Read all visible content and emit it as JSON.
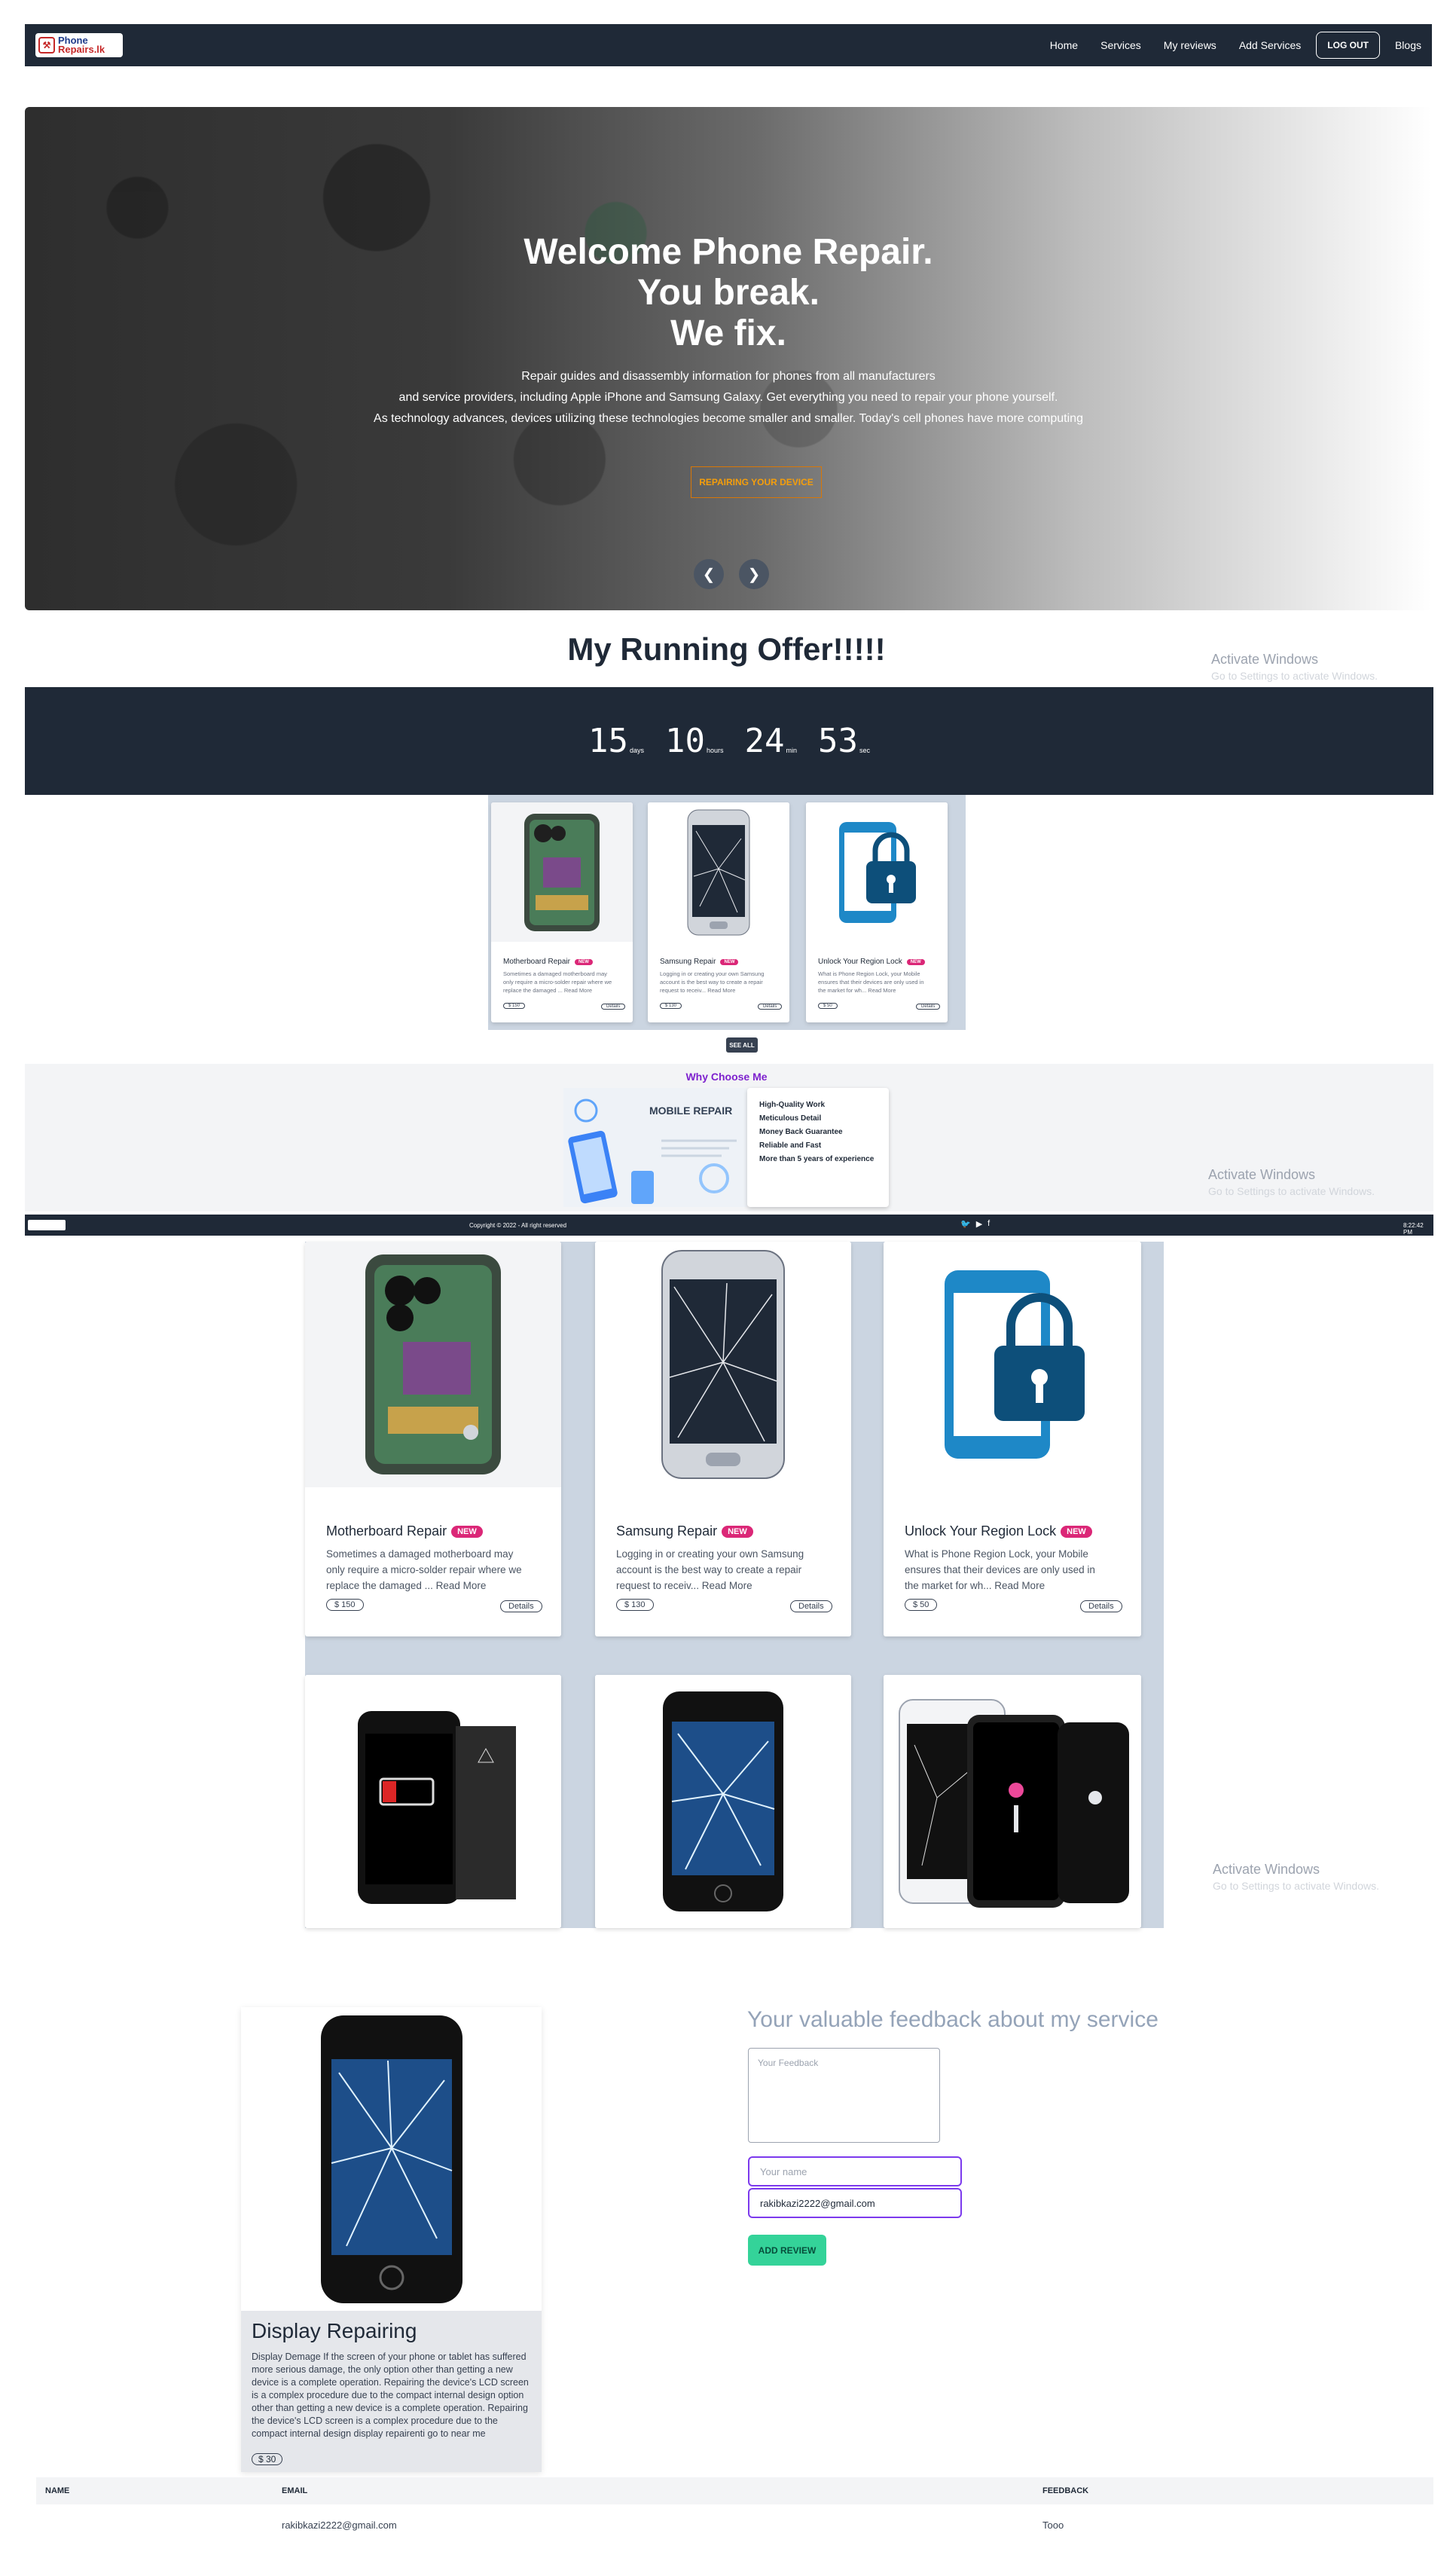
{
  "nav": {
    "logo_text_1": "Phone",
    "logo_text_2": "Repairs.lk",
    "items": [
      {
        "label": "Home"
      },
      {
        "label": "Services"
      },
      {
        "label": "My reviews"
      },
      {
        "label": "Add Services"
      },
      {
        "label": "LOG OUT"
      },
      {
        "label": "Blogs"
      }
    ]
  },
  "hero": {
    "title_1": "Welcome Phone Repair.",
    "title_2": "You break.",
    "title_3": "We fix.",
    "text_1": "Repair guides and disassembly information for phones from all manufacturers",
    "text_2": "and service providers, including Apple iPhone and Samsung Galaxy. Get everything you need to repair your phone yourself.",
    "text_3": "As technology advances, devices utilizing these technologies become smaller and smaller. Today's cell phones have more computing",
    "button": "REPAIRING YOUR DEVICE",
    "prev": "❮",
    "next": "❯"
  },
  "offer": {
    "title": "My Running Offer!!!!!",
    "countdown": [
      {
        "value": "15",
        "unit": "days"
      },
      {
        "value": "10",
        "unit": "hours"
      },
      {
        "value": "24",
        "unit": "min"
      },
      {
        "value": "53",
        "unit": "sec"
      }
    ]
  },
  "watermark": {
    "line1": "Activate Windows",
    "line2": "Go to Settings to activate Windows."
  },
  "services": [
    {
      "title": "Motherboard Repair",
      "badge": "NEW",
      "desc_1": "Sometimes a damaged motherboard may",
      "desc_2": "only require a micro-solder repair where we",
      "desc_3": "replace the damaged ... Read More",
      "price": "$ 150",
      "details": "Details"
    },
    {
      "title": "Samsung Repair",
      "badge": "NEW",
      "desc_1": "Logging in or creating your own Samsung",
      "desc_2": "account is the best way to create a repair",
      "desc_3": "request to receiv... Read More",
      "price": "$ 130",
      "details": "Details"
    },
    {
      "title": "Unlock Your Region Lock",
      "badge": "NEW",
      "desc_1": "What is Phone Region Lock, your Mobile",
      "desc_2": "ensures that their devices are only used in",
      "desc_3": "the market for wh... Read More",
      "price": "$ 50",
      "details": "Details"
    }
  ],
  "see_all": "SEE ALL",
  "why": {
    "title": "Why Choose Me",
    "image_text": "MOBILE REPAIR",
    "items": [
      "High-Quality Work",
      "Meticulous Detail",
      "Money Back Guarantee",
      "Reliable and Fast",
      "More than 5 years of experience"
    ]
  },
  "footer": {
    "copyright": "Copyright © 2022 - All right reserved",
    "time": "8:22:42 PM"
  },
  "review_card": {
    "title": "Display Repairing",
    "desc": "Display Demage If the screen of your phone or tablet has suffered more serious damage, the only option other than getting a new device is a complete operation. Repairing the device's LCD screen is a complex procedure due to the compact internal design option other than getting a new device is a complete operation. Repairing the device's LCD screen is a complex procedure due to the compact internal design display repairenti go to near me",
    "price": "$ 30"
  },
  "feedback": {
    "title": "Your valuable feedback about my service",
    "text_placeholder": "Your Feedback",
    "name_placeholder": "Your name",
    "email_value": "rakibkazi2222@gmail.com",
    "button": "ADD REVIEW"
  },
  "table": {
    "headers": [
      "NAME",
      "EMAIL",
      "FEEDBACK"
    ],
    "rows": [
      {
        "name": "",
        "email": "rakibkazi2222@gmail.com",
        "feedback": "Tooo"
      }
    ]
  },
  "colors": {
    "nav": "#1f2937",
    "badge": "#db2777",
    "accent": "#7e22ce",
    "button_green": "#34d399"
  }
}
